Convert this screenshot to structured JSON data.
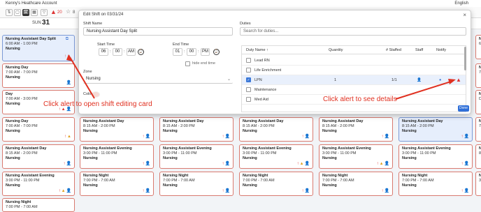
{
  "account": "Kenny's Heathcare Account",
  "language": "English",
  "toolbar": {
    "buttons": [
      "⇅",
      "▢",
      "🗓",
      "▦",
      "▽"
    ],
    "alert_count": "20",
    "star_count": "8"
  },
  "day": {
    "weekday": "SUN",
    "date": "31"
  },
  "dialog": {
    "title": "Edit Shift on 03/31/24",
    "close": "×",
    "shift_name_label": "Shift Name",
    "shift_name": "Nursing Assistant Day Split",
    "start_time_label": "Start Time",
    "start_hour": "06",
    "start_min": "00",
    "start_ampm": "AM",
    "end_time_label": "End Time",
    "end_hour": "01",
    "end_min": "00",
    "end_ampm": "PM",
    "hide_end_label": "hide end time",
    "zone_label": "Zone",
    "zone_value": "Nursing",
    "color_label": "Color",
    "duties_label": "Duties",
    "duties_placeholder": "Search for duties...",
    "table_headers": {
      "name": "Duty Name ↑",
      "qty": "Quantity",
      "staffed": "# Staffed",
      "staff": "Staff",
      "notify": "Notify"
    },
    "duties": [
      {
        "name": "Lead RN",
        "qty": "",
        "staffed": "",
        "checked": false
      },
      {
        "name": "Life Enrichment",
        "qty": "",
        "staffed": "",
        "checked": false
      },
      {
        "name": "LPN",
        "qty": "1",
        "staffed": "1/1",
        "checked": true
      },
      {
        "name": "Maintenance",
        "qty": "",
        "staffed": "",
        "checked": false
      },
      {
        "name": "Med Aid",
        "qty": "",
        "staffed": "",
        "checked": false
      }
    ],
    "done": "Done"
  },
  "annotations": {
    "left": "Click alert to open shift editing card",
    "right": "Click alert to see details"
  },
  "cards": [
    {
      "title": "Nursing Assistant Day Split",
      "time": "6:00 AM - 1:00 PM",
      "role": "Nursing"
    },
    {
      "title": "Nursing Day",
      "time": "7:00 AM - 7:00 PM",
      "role": "Nursing"
    },
    {
      "title": "Day",
      "time": "7:00 AM - 3:00 PM",
      "role": "Nursing"
    },
    {
      "title": "Nursing Day",
      "time": "7:00 AM - 7:00 PM",
      "role": "Nursing"
    },
    {
      "title": "Nursing Assistant Day",
      "time": "8:15 AM - 2:00 PM",
      "role": "Nursing"
    },
    {
      "title": "Nursing Assistant Evening",
      "time": "3:00 PM - 11:00 PM",
      "role": "Nursing"
    },
    {
      "title": "Nursing Night",
      "time": "7:00 PM - 7:00 AM",
      "role": "Nursing"
    }
  ],
  "grid": {
    "row_titles": [
      "Nursing Assistant Day",
      "Nursing Assistant Evening",
      "Nursing Night"
    ],
    "row_times": [
      "8:15 AM - 2:00 PM",
      "3:00 PM - 11:00 PM",
      "7:00 PM - 7:00 AM"
    ],
    "role": "Nursing",
    "edge_titles": [
      "Nursi",
      "Nursi",
      "Nursi",
      "Nursi",
      "Nursi",
      "Nursi"
    ],
    "edge_times": [
      "6:00",
      "7:00",
      "D",
      "7:00",
      "8:15",
      "3:00"
    ],
    "tiny_labels": [
      "N",
      "D",
      "7",
      "N"
    ],
    "sup": "N"
  },
  "colors": {
    "alert": "#d33",
    "accent": "#2f6fd8",
    "card_border": "#d97a70",
    "annotation": "#e03020"
  }
}
